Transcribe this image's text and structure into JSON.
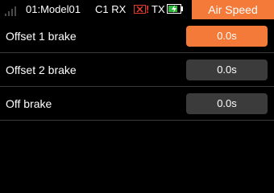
{
  "status": {
    "model": "01:Model01",
    "rx_label": "C1 RX",
    "rx_alert": "!",
    "tx_label": "TX",
    "tx_battery_level": 0.75,
    "title": "Air Speed"
  },
  "settings": [
    {
      "label": "Offset 1 brake",
      "value": "0.0s",
      "selected": true
    },
    {
      "label": "Offset 2 brake",
      "value": "0.0s",
      "selected": false
    },
    {
      "label": "Off brake",
      "value": "0.0s",
      "selected": false
    }
  ],
  "colors": {
    "accent": "#f47a3a",
    "value_bg": "#3b3b3b",
    "alert": "#e23b2e",
    "battery": "#2db83d"
  }
}
